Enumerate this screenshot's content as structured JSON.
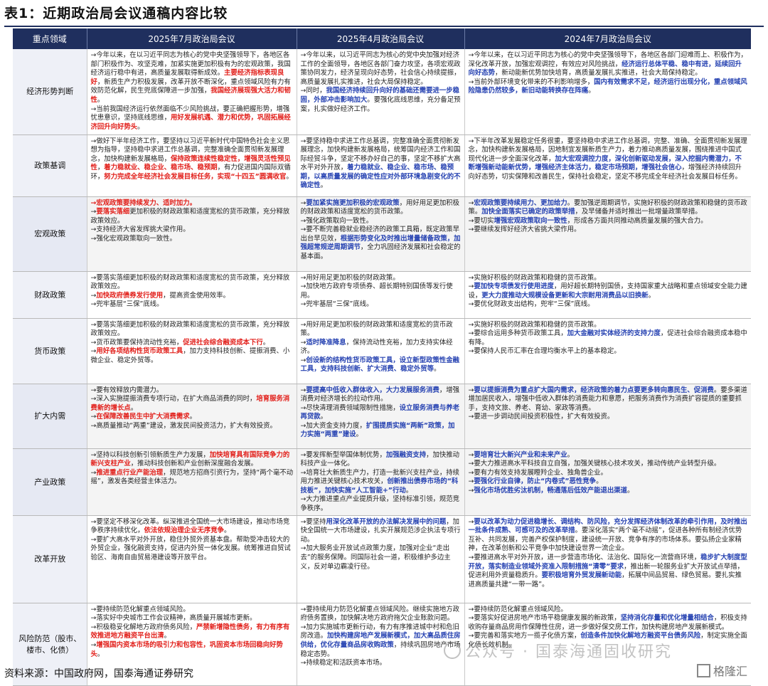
{
  "title": "表1：近期政治局会议通稿内容比较",
  "headers": [
    "重点领域",
    "2025年7月政治局会议",
    "2025年4月政治局会议",
    "2024年7月政治局会议"
  ],
  "rows": [
    {
      "area": "经济形势判断",
      "cells": [
        [
          [
            [
              "n",
              "→今年以来，在以习近平同志为核心的党中央坚强领导下，各地区各部门积极作为、攻坚克难，加紧实施更加积极有为的宏观政策，我国经济运行稳中有进，高质量发展取得新成效。"
            ],
            [
              "r",
              "主要经济指标表现良好"
            ],
            [
              "n",
              "，新质生产力积极发展，改革开放不断深化，重点领域风险有力有效防范化解，民生兜底保障进一步加强，"
            ],
            [
              "r",
              "我国经济展现强大活力和韧性"
            ],
            [
              "n",
              "。"
            ]
          ],
          [
            [
              "n",
              "→当前我国经济运行依然面临不少风险挑战，要正确把握形势，增强忧患意识，坚持底线思维，"
            ],
            [
              "r",
              "用好发展机遇、潜力和优势，巩固拓展经济回升向好势头"
            ],
            [
              "n",
              "。"
            ]
          ]
        ],
        [
          [
            [
              "n",
              "→今年以来，以习近平同志为核心的党中央加强对经济工作的全面领导，各地区各部门奋力攻坚，各项宏观政策协同发力，经济呈现向好态势，社会信心持续提振，高质量发展扎实推进，社会大局保持稳定。"
            ]
          ],
          [
            [
              "n",
              "→同时，"
            ],
            [
              "b",
              "我国经济持续回升向好的基础还需要进一步稳固，外部冲击影响加大"
            ],
            [
              "n",
              "。要强化底线思维，充分备足预案，扎实做好经济工作。"
            ]
          ]
        ],
        [
          [
            [
              "n",
              "→今年以来，在以习近平同志为核心的党中央坚强领导下，各地区各部门迎难而上、积极作为，深化改革开放，加强宏观调控，有效应对风险挑战，"
            ],
            [
              "b",
              "经济运行总体平稳、稳中有进，延续回升向好态势"
            ],
            [
              "n",
              "，新动能新优势加快培育，高质量发展扎实推进，社会大局保持稳定。"
            ]
          ],
          [
            [
              "n",
              "→当前外部环境变化带来的不利影响增多，"
            ],
            [
              "b",
              "国内有效需求不足，经济运行出现分化，重点领域风险隐患仍然较多，新旧动能转换存在阵痛"
            ],
            [
              "n",
              "。"
            ]
          ]
        ]
      ]
    },
    {
      "area": "政策基调",
      "cells": [
        [
          [
            [
              "n",
              "→做好下半年经济工作，要坚持以习近平新时代中国特色社会主义思想为指导，坚持稳中求进工作总基调，完整准确全面贯彻新发展理念，加快构建新发展格局，"
            ],
            [
              "r",
              "保持政策连续性稳定性，增强灵活性预见性"
            ],
            [
              "n",
              "，"
            ],
            [
              "r",
              "着力稳就业、稳企业、稳市场、稳预期"
            ],
            [
              "n",
              "，有力促进国内国际双循环，"
            ],
            [
              "r",
              "努力完成全年经济社会发展目标任务，实现“十四五”圆满收官"
            ],
            [
              "n",
              "。"
            ]
          ]
        ],
        [
          [
            [
              "n",
              "→要坚持稳中求进工作总基调，完整准确全面贯彻新发展理念，加快构建新发展格局，统筹国内经济工作和国际经贸斗争，坚定不移办好自己的事，坚定不移扩大高水平对外开放，"
            ],
            [
              "b",
              "着力稳就业、稳企业、稳市场、稳预期，以高质量发展的确定性应对外部环境急剧变化的不确定性"
            ],
            [
              "n",
              "。"
            ]
          ]
        ],
        [
          [
            [
              "n",
              "→下半年改革发展稳定任务很重，要坚持稳中求进工作总基调，完整、准确、全面贯彻新发展理念，加快构建新发展格局，因地制宜发展新质生产力，着力推动高质量发展，围绕推进中国式现代化进一步全面深化改革，"
            ],
            [
              "b",
              "加大宏观调控力度，深化创新驱动发展，深入挖掘内需潜力，不断增强新动能新优势，增强经济主体活力，稳定市场预期，增强社会信心"
            ],
            [
              "n",
              "，增强经济持续回升向好态势，切实保障和改善民生，保持社会稳定，坚定不移完成全年经济社会发展目标任务。"
            ]
          ]
        ]
      ]
    },
    {
      "area": "宏观政策",
      "alt": true,
      "cells": [
        [
          [
            [
              "r",
              "→宏观政策要持续发力、适时加力。"
            ]
          ],
          [
            [
              "n",
              "→"
            ],
            [
              "r",
              "要落实落细"
            ],
            [
              "n",
              "更加积极的财政政策和适度宽松的货币政策，充分释放政策效应。"
            ]
          ],
          [
            [
              "n",
              "→支持经济大省发挥挑大梁作用。"
            ]
          ],
          [
            [
              "n",
              "→强化宏观政策取向一致性。"
            ]
          ]
        ],
        [
          [
            [
              "n",
              "→"
            ],
            [
              "b",
              "要加紧实施更加积极的宏观政策"
            ],
            [
              "n",
              "，用好用足更加积极的财政政策和适度宽松的货币政策。"
            ]
          ],
          [
            [
              "n",
              "→强化政策取向一致性。"
            ]
          ],
          [
            [
              "n",
              "→要不断完善稳就业稳经济的政策工具箱，既定政策早出台早见效，"
            ],
            [
              "b",
              "根据形势变化及时推出增量储备政策，加强超常规逆周期调节"
            ],
            [
              "n",
              "，全力巩固经济发展和社会稳定的基本面。"
            ]
          ]
        ],
        [
          [
            [
              "n",
              "→"
            ],
            [
              "b",
              "宏观政策要持续用力、更加给力"
            ],
            [
              "n",
              "。要加强逆周期调节，实施好积极的财政政策和稳健的货币政策。"
            ],
            [
              "b",
              "加快全面落实已确定的政策举措"
            ],
            [
              "n",
              "，及早储备并适时推出一批增量政策举措。"
            ]
          ],
          [
            [
              "n",
              "→要切实"
            ],
            [
              "b",
              "增强宏观政策取向一致性"
            ],
            [
              "n",
              "，形成各方面共同推动高质量发展的强大合力。"
            ]
          ],
          [
            [
              "n",
              "→要继续发挥好经济大省挑大梁作用。"
            ]
          ]
        ]
      ]
    },
    {
      "area": "财政政策",
      "cells": [
        [
          [
            [
              "n",
              "→要落实落细更加积极的财政政策和适度宽松的货币政策，充分释放政策效应。"
            ]
          ],
          [
            [
              "n",
              "→"
            ],
            [
              "r",
              "加快政府债券发行使用"
            ],
            [
              "n",
              "，提高资金使用效率。"
            ]
          ],
          [
            [
              "n",
              "→兜牢基层“三保”底线。"
            ]
          ]
        ],
        [
          [
            [
              "n",
              "→用好用足更加积极的财政政策。"
            ]
          ],
          [
            [
              "n",
              "→加快地方政府专项债券、超长期特别国债等发行使用。"
            ]
          ],
          [
            [
              "n",
              "→兜牢基层“三保”底线。"
            ]
          ]
        ],
        [
          [
            [
              "n",
              "→实施好积极的财政政策和稳健的货币政策。"
            ]
          ],
          [
            [
              "n",
              "→"
            ],
            [
              "b",
              "要加快专项债发行使用进度"
            ],
            [
              "n",
              "，用好超长期特别国债，支持国家重大战略和重点领域安全能力建设，"
            ],
            [
              "b",
              "更大力度推动大规模设备更新和大宗耐用消费品以旧换新"
            ],
            [
              "n",
              "。"
            ]
          ],
          [
            [
              "n",
              "→要优化财政支出结构，兜牢“三保”底线。"
            ]
          ]
        ]
      ]
    },
    {
      "area": "货币政策",
      "cells": [
        [
          [
            [
              "n",
              "→要落实落细更加积极的财政政策和适度宽松的货币政策，充分释放政策效应。"
            ]
          ],
          [
            [
              "n",
              "→货币政策要保持流动性充裕，"
            ],
            [
              "r",
              "促进社会综合融资成本下行"
            ],
            [
              "n",
              "。"
            ]
          ],
          [
            [
              "n",
              "→"
            ],
            [
              "r",
              "用好各项结构性货币政策工具"
            ],
            [
              "n",
              "，加力支持科技创新、提振消费、小微企业、稳定外贸等。"
            ]
          ]
        ],
        [
          [
            [
              "n",
              "→用好用足更加积极的财政政策和适度宽松的货币政策。"
            ]
          ],
          [
            [
              "n",
              "→"
            ],
            [
              "b",
              "适时降准降息"
            ],
            [
              "n",
              "，保持流动性充裕，加力支持实体经济。"
            ]
          ],
          [
            [
              "n",
              "→"
            ],
            [
              "b",
              "创设新的结构性货币政策工具，设立新型政策性金融工具，支持科技创新、扩大消费、稳定外贸等"
            ],
            [
              "n",
              "。"
            ]
          ]
        ],
        [
          [
            [
              "n",
              "→实施好积极的财政政策和稳健的货币政策。"
            ]
          ],
          [
            [
              "n",
              "→要综合运用多种货币政策工具，"
            ],
            [
              "b",
              "加大金融对实体经济的支持力度"
            ],
            [
              "n",
              "，促进社会综合融资成本稳中有降。"
            ]
          ],
          [
            [
              "n",
              "→要保持人民币汇率在合理均衡水平上的基本稳定。"
            ]
          ]
        ]
      ]
    },
    {
      "area": "扩大内需",
      "alt": true,
      "cells": [
        [
          [
            [
              "n",
              "→要有效释放内需潜力。"
            ]
          ],
          [
            [
              "n",
              "→深入实施提振消费专项行动，在扩大商品消费的同时，"
            ],
            [
              "r",
              "培育服务消费新的增长点"
            ],
            [
              "n",
              "。"
            ]
          ],
          [
            [
              "n",
              "→"
            ],
            [
              "r",
              "在保障改善民生中扩大消费需求"
            ],
            [
              "n",
              "。"
            ]
          ],
          [
            [
              "n",
              "→高质量推动“两重”建设，激发民间投资活力，扩大有效投资。"
            ]
          ]
        ],
        [
          [
            [
              "n",
              "→"
            ],
            [
              "b",
              "要提高中低收入群体收入，大力发展服务消费"
            ],
            [
              "n",
              "，增强消费对经济增长的拉动作用。"
            ]
          ],
          [
            [
              "n",
              "→尽快清理消费领域限制性措施，"
            ],
            [
              "b",
              "设立服务消费与养老再贷款"
            ],
            [
              "n",
              "。"
            ]
          ],
          [
            [
              "n",
              "→加大资金支持力度，"
            ],
            [
              "b",
              "扩围提质实施“两新”政策，加力实施“两重”建设"
            ],
            [
              "n",
              "。"
            ]
          ]
        ],
        [
          [
            [
              "n",
              "→"
            ],
            [
              "b",
              "要以提振消费为重点扩大国内需求，经济政策的着力点要更多转向惠民生、促消费"
            ],
            [
              "n",
              "。要多渠道增加居民收入，增强中低收入群体的消费能力和意愿，把服务消费作为消费扩容提质的重要抓手，支持文旅、养老、育幼、家政等消费。"
            ]
          ],
          [
            [
              "n",
              "→要进一步调动民间投资积极性，扩大有效投资。"
            ]
          ]
        ]
      ]
    },
    {
      "area": "产业政策",
      "alt": true,
      "cells": [
        [
          [
            [
              "n",
              "→坚持以科技创新引领新质生产力发展，"
            ],
            [
              "r",
              "加快培育具有国际竞争力的新兴支柱产业"
            ],
            [
              "n",
              "，推动科技创新和产业创新深度融合发展。"
            ]
          ],
          [
            [
              "n",
              "→"
            ],
            [
              "r",
              "推进重点行业产能治理"
            ],
            [
              "n",
              "，规范地方招商引资行为，坚持“两个毫不动摇”，激发各类经营主体活力。"
            ]
          ]
        ],
        [
          [
            [
              "n",
              "→要发挥新型举国体制优势，"
            ],
            [
              "b",
              "加强融资支持"
            ],
            [
              "n",
              "，加快推动科技产业一体化。"
            ]
          ],
          [
            [
              "n",
              "→培育壮大新质生产力，打造一批新兴支柱产业，持续用力推进关键核心技术攻关，"
            ],
            [
              "b",
              "创新推出债券市场的“科技板”，加快实施“人工智能+”行动"
            ],
            [
              "n",
              "。"
            ]
          ],
          [
            [
              "n",
              "→大力推进重点产业提质升级，坚持标准引领，规范竞争秩序。"
            ]
          ]
        ],
        [
          [
            [
              "n",
              "→"
            ],
            [
              "b",
              "要培育壮大新兴产业和未来产业"
            ],
            [
              "n",
              "。"
            ]
          ],
          [
            [
              "n",
              "→要大力推进高水平科技自立自强，加强关键核心技术攻关，推动传统产业转型升级。"
            ]
          ],
          [
            [
              "n",
              "→要有力有效支持发展瞪羚企业、独角兽企业。"
            ]
          ],
          [
            [
              "n",
              "→"
            ],
            [
              "b",
              "要强化行业自律，防止“内卷式”恶性竞争"
            ],
            [
              "n",
              "。"
            ]
          ],
          [
            [
              "n",
              "→"
            ],
            [
              "b",
              "强化市场优胜劣汰机制，畅通落后低效产能退出渠道"
            ],
            [
              "n",
              "。"
            ]
          ]
        ]
      ]
    },
    {
      "area": "改革开放",
      "cells": [
        [
          [
            [
              "n",
              "→要坚定不移深化改革。纵深推进全国统一大市场建设，推动市场竞争秩序持续优化，"
            ],
            [
              "r",
              "依法依规治理企业无序竞争"
            ],
            [
              "n",
              "。"
            ]
          ],
          [
            [
              "n",
              "→要扩大高水平对外开放，稳住外贸外资基本盘。帮助受冲击较大的外贸企业，强化融资支持，促进内外贸一体化发展。统筹推进自贸试验区、海南自由贸易港建设等开放平台。"
            ]
          ]
        ],
        [
          [
            [
              "n",
              "→要坚持"
            ],
            [
              "b",
              "用深化改革开放的办法解决发展中的问题"
            ],
            [
              "n",
              "，加快全国统一大市场建设，扎实开展规范涉企执法专项行动。"
            ]
          ],
          [
            [
              "n",
              "→加大服务业开放试点政策力度，加强对企业“走出去”的服务保障。同国际社会一道，积极维护多边主义，反对单边霸凌行径。"
            ]
          ]
        ],
        [
          [
            [
              "n",
              "→"
            ],
            [
              "b",
              "要以改革为动力促进稳增长、调结构、防风险，充分发挥经济体制改革的牵引作用，及时推出一批条件成熟、可感可及的改革举措"
            ],
            [
              "n",
              "。要深化落实“两个毫不动摇”，促进各种所有制经济优势互补、共同发展，完善产权保护制度，建设统一开放、竞争有序的市场体系。要弘扬企业家精神，在改革创新和公平竞争中加快建设世界一流企业。"
            ]
          ],
          [
            [
              "n",
              "→要推进高水平对外开放，进一步营造市场化、法治化、国际化一流营商环境，"
            ],
            [
              "b",
              "稳步扩大制度型开放，落实制造业领域外资准入限制措施“清零”要求"
            ],
            [
              "n",
              "，推出新一轮服务业扩大开放试点举措，促进利用外资量稳质升。"
            ],
            [
              "b",
              "要积极培育外贸发展新动能"
            ],
            [
              "n",
              "，拓展中间品贸易、绿色贸易。要扎实推进高质量共建“一带一路”。"
            ]
          ]
        ]
      ]
    },
    {
      "area": "风险防范（股市、楼市、化债）",
      "cells": [
        [
          [
            [
              "n",
              "→要持续防范化解重点领域风险。"
            ]
          ],
          [
            [
              "n",
              "→落实好中央城市工作会议精神，高质量开展城市更新。"
            ]
          ],
          [
            [
              "n",
              "→积极稳妥化解地方政府债务风险，"
            ],
            [
              "r",
              "严禁新增隐性债务，有力有序有效推进地方融资平台出清"
            ],
            [
              "n",
              "。"
            ]
          ],
          [
            [
              "n",
              "→"
            ],
            [
              "r",
              "增强国内资本市场的吸引力和包容性，巩固资本市场回稳向好势头"
            ],
            [
              "n",
              "。"
            ]
          ]
        ],
        [
          [
            [
              "n",
              "→要持续用力防范化解重点领域风险。继续实施地方政府债务置换，加快解决地方政府拖欠企业账款问题。"
            ]
          ],
          [
            [
              "n",
              "→加力实施城市更新行动，有力有序推进城中村和危旧房改造。"
            ],
            [
              "b",
              "加快构建房地产发展新模式，加大高品质住房供给，优化存量商品房收购政策"
            ],
            [
              "n",
              "，持续巩固房地产市场稳定态势。"
            ]
          ],
          [
            [
              "n",
              "→持续稳定和活跃资本市场。"
            ]
          ]
        ],
        [
          [
            [
              "n",
              "→要持续防范化解重点领域风险。"
            ]
          ],
          [
            [
              "n",
              "→要落实好促进房地产市场平稳健康发展的新政策，"
            ],
            [
              "b",
              "坚持消化存量和优化增量相结合"
            ],
            [
              "n",
              "，积极支持收购存量商品房用作保障性住房，进一步做好保交房工作，加快构建房地产发展新模式。"
            ]
          ],
          [
            [
              "n",
              "→要完善和落实地方一揽子化债方案，"
            ],
            [
              "b",
              "创造条件加快化解地方融资平台债务风险"
            ],
            [
              "n",
              "，制定实施全面化债长效机制。"
            ]
          ]
        ]
      ]
    }
  ],
  "source": "资料来源：中国政府网，国泰海通证券研究",
  "watermark": "公众号 · 国泰海通固收研究",
  "logo": "格隆汇"
}
